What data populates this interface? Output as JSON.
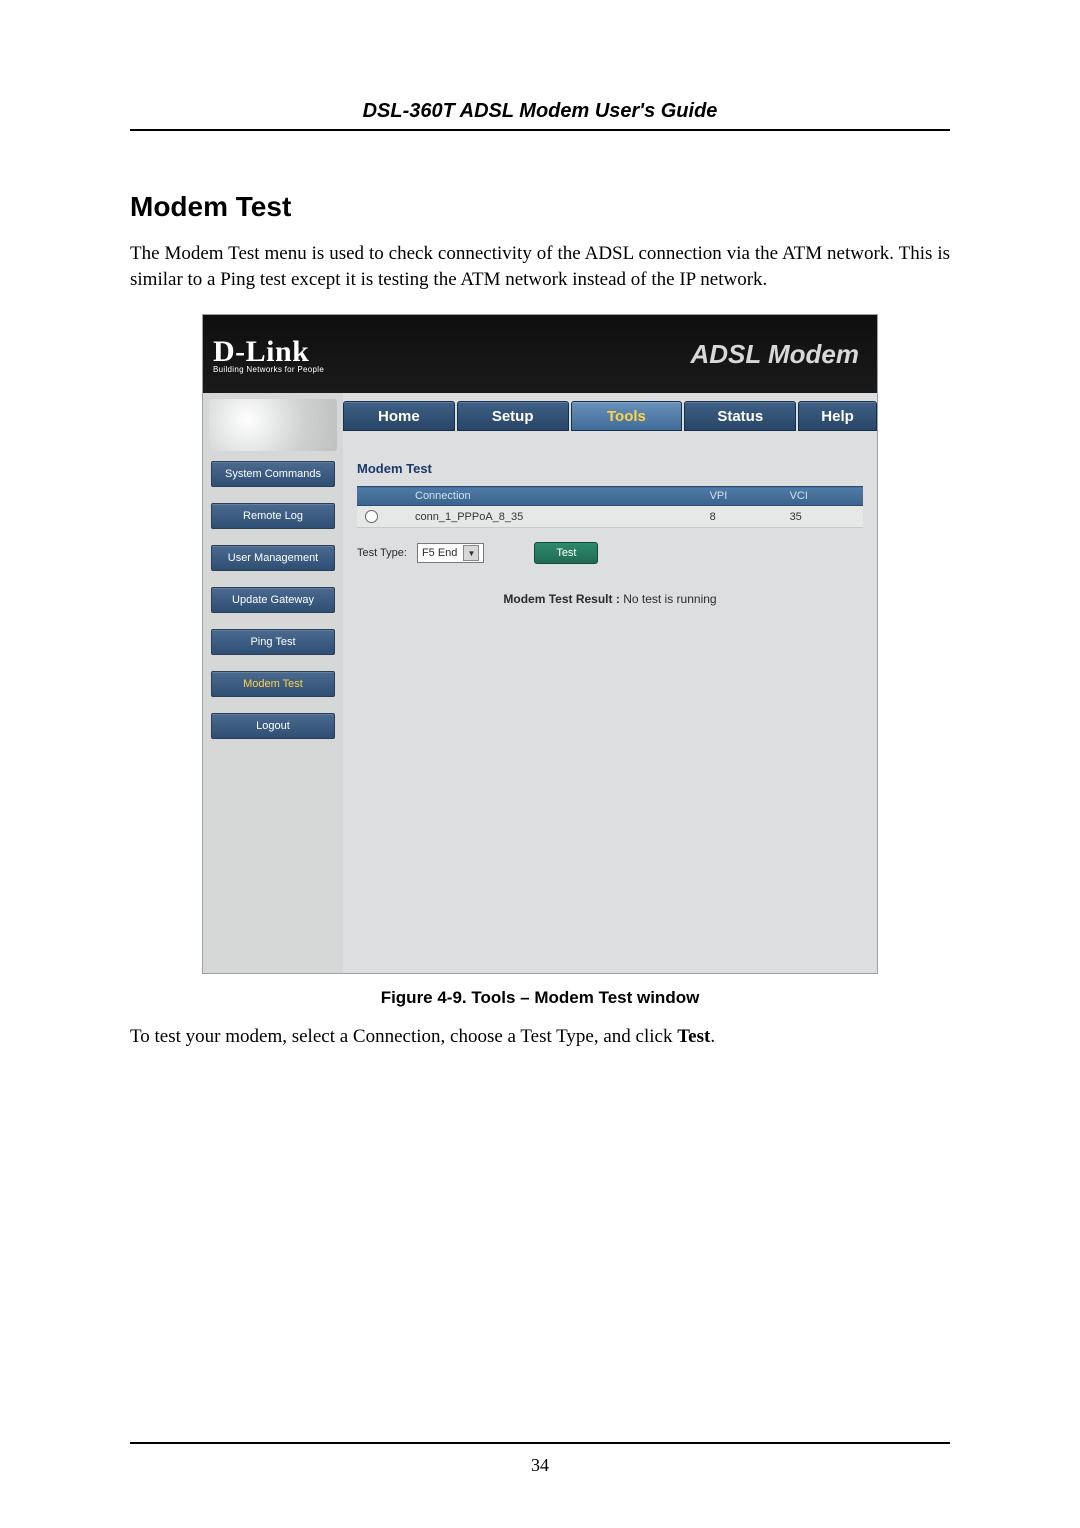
{
  "doc": {
    "header_title": "DSL-360T ADSL Modem User's Guide",
    "section_heading": "Modem Test",
    "intro_para": "The Modem Test menu is used to check connectivity of the ADSL connection via the ATM network. This is similar to a Ping test except it is testing the ATM network instead of the IP network.",
    "figure_caption": "Figure 4-9. Tools – Modem Test window",
    "outro_prefix": "To test your modem, select a Connection, choose a Test Type, and click ",
    "outro_bold": "Test",
    "outro_suffix": ".",
    "page_number": "34"
  },
  "router": {
    "brand": "D-Link",
    "brand_tag": "Building Networks for People",
    "product": "ADSL Modem",
    "tabs": {
      "home": "Home",
      "setup": "Setup",
      "tools": "Tools",
      "status": "Status",
      "help": "Help"
    },
    "sidebar": {
      "system_commands": "System Commands",
      "remote_log": "Remote Log",
      "user_management": "User Management",
      "update_gateway": "Update Gateway",
      "ping_test": "Ping Test",
      "modem_test": "Modem Test",
      "logout": "Logout"
    },
    "panel": {
      "title": "Modem Test",
      "col_connection": "Connection",
      "col_vpi": "VPI",
      "col_vci": "VCI",
      "row_connection": "conn_1_PPPoA_8_35",
      "row_vpi": "8",
      "row_vci": "35",
      "test_type_label": "Test Type:",
      "test_type_value": "F5 End",
      "test_button": "Test",
      "result_label": "Modem Test Result :",
      "result_value": "No test is running"
    }
  }
}
